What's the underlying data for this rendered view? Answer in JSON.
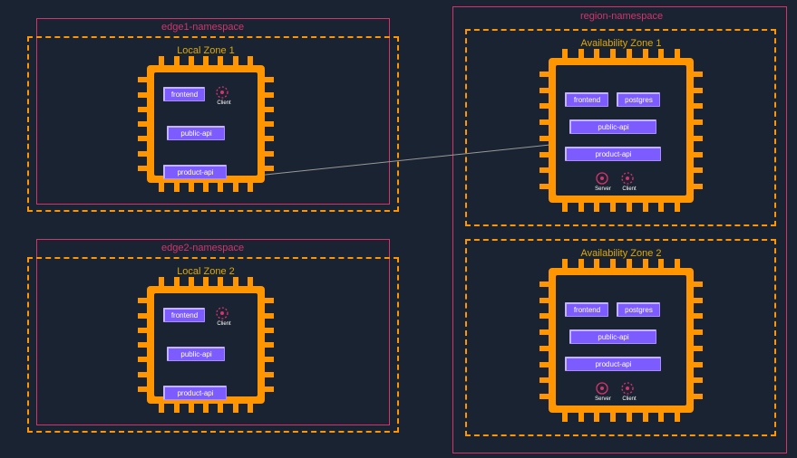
{
  "namespaces": {
    "edge1": {
      "label": "edge1-namespace"
    },
    "edge2": {
      "label": "edge2-namespace"
    },
    "region": {
      "label": "region-namespace"
    }
  },
  "zones": {
    "local1": {
      "label": "Local Zone 1"
    },
    "local2": {
      "label": "Local Zone 2"
    },
    "az1": {
      "label": "Availability Zone 1"
    },
    "az2": {
      "label": "Availability Zone 2"
    }
  },
  "services": {
    "frontend": "frontend",
    "public_api": "public-api",
    "product_api": "product-api",
    "postgres": "postgres"
  },
  "icons": {
    "client": "Client",
    "server": "Server"
  },
  "chart_data": {
    "type": "diagram",
    "description": "AWS architecture showing two edge namespaces (edge1, edge2) each containing a Local Zone with frontend, public-api, product-api services and a Consul client. A region-namespace contains two Availability Zones, each with frontend, postgres, public-api, product-api services plus Consul server and client. product-api in Local Zone 1 connects to public-api in Availability Zone 1.",
    "nodes": [
      {
        "id": "edge1",
        "type": "namespace",
        "label": "edge1-namespace",
        "children": [
          "lz1"
        ]
      },
      {
        "id": "edge2",
        "type": "namespace",
        "label": "edge2-namespace",
        "children": [
          "lz2"
        ]
      },
      {
        "id": "region",
        "type": "namespace",
        "label": "region-namespace",
        "children": [
          "az1",
          "az2"
        ]
      },
      {
        "id": "lz1",
        "type": "zone",
        "label": "Local Zone 1",
        "services": [
          "frontend",
          "public-api",
          "product-api"
        ],
        "consul": [
          "Client"
        ]
      },
      {
        "id": "lz2",
        "type": "zone",
        "label": "Local Zone 2",
        "services": [
          "frontend",
          "public-api",
          "product-api"
        ],
        "consul": [
          "Client"
        ]
      },
      {
        "id": "az1",
        "type": "zone",
        "label": "Availability Zone 1",
        "services": [
          "frontend",
          "postgres",
          "public-api",
          "product-api"
        ],
        "consul": [
          "Server",
          "Client"
        ]
      },
      {
        "id": "az2",
        "type": "zone",
        "label": "Availability Zone 2",
        "services": [
          "frontend",
          "postgres",
          "public-api",
          "product-api"
        ],
        "consul": [
          "Server",
          "Client"
        ]
      }
    ],
    "edges": [
      {
        "from": "lz1.product-api",
        "to": "az1.public-api"
      }
    ]
  }
}
